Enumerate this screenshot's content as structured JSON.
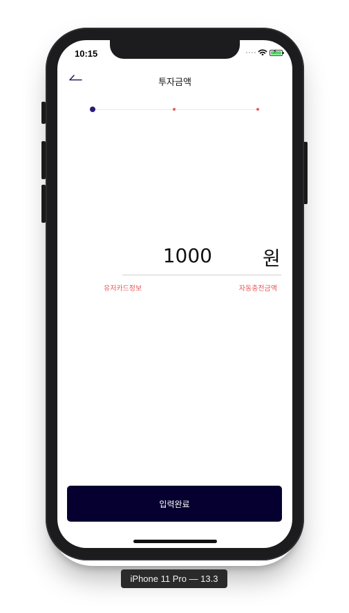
{
  "status_bar": {
    "time": "10:15",
    "icons": [
      "cellular-signal-icon",
      "wifi-icon",
      "battery-charging-icon"
    ]
  },
  "nav": {
    "back_icon": "back-arrow-icon",
    "title": "투자금액"
  },
  "stepper": {
    "total_steps": 3,
    "current_step": 1,
    "active_color": "#2c1a78",
    "inactive_color": "#ea5b5b"
  },
  "amount": {
    "value": "1000",
    "unit": "원"
  },
  "links": {
    "left": "유저카드정보",
    "right": "자동충전금액",
    "color": "#e85656"
  },
  "submit": {
    "label": "입력완료",
    "bg_color": "#05002f"
  },
  "device_label": "iPhone 11 Pro — 13.3"
}
